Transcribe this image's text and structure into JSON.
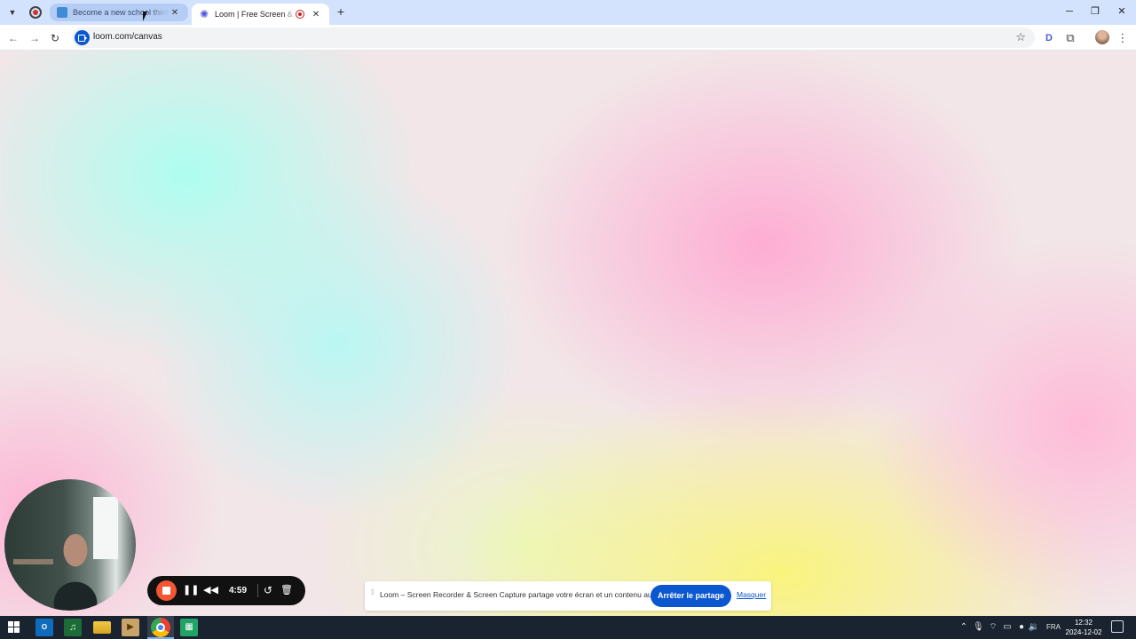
{
  "browser": {
    "tabs": [
      {
        "title": "Become a new school thinker w",
        "active": false
      },
      {
        "title": "Loom | Free Screen & Video",
        "active": true
      }
    ],
    "new_tab_icon": "plus-icon",
    "window_controls": {
      "minimize": "─",
      "restore": "❐",
      "close": "✕"
    },
    "address_bar": {
      "url": "loom.com/canvas"
    }
  },
  "recorder": {
    "elapsed": "4:59",
    "stop_color": "#f25633"
  },
  "share_notice": {
    "message": "Loom – Screen Recorder & Screen Capture partage votre écran et un contenu audio.",
    "stop_label": "Arrêter le partage",
    "hide_label": "Masquer"
  },
  "taskbar": {
    "outlook_label": "O",
    "language": "FRA",
    "time": "12:32",
    "date": "2024-12-02"
  },
  "colors": {
    "accent": "#0b57d0",
    "tabstrip": "#d3e3fd",
    "taskbar": "#1a2431"
  }
}
